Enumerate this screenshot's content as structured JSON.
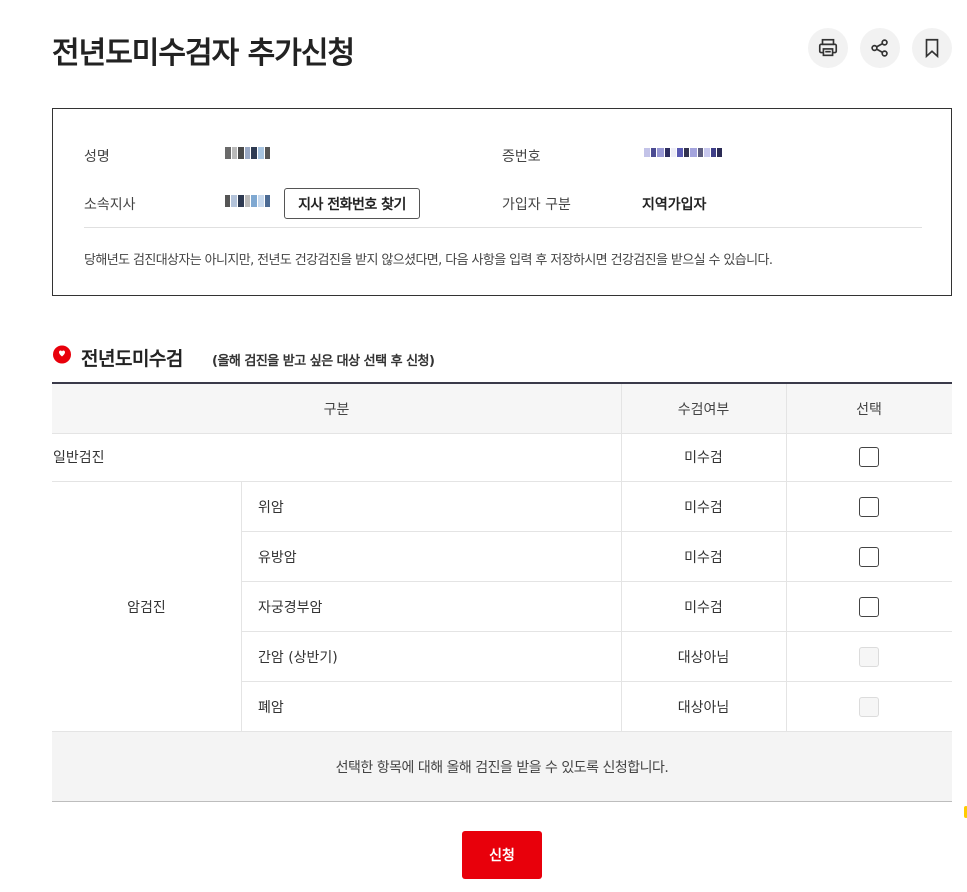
{
  "page": {
    "title": "전년도미수검자 추가신청"
  },
  "toolbar": {
    "print_icon": "print-icon",
    "share_icon": "share-icon",
    "bookmark_icon": "bookmark-icon"
  },
  "info": {
    "name_label": "성명",
    "id_label": "증번호",
    "branch_label": "소속지사",
    "find_phone_label": "지사 전화번호 찾기",
    "member_type_label": "가입자 구분",
    "member_type_value": "지역가입자",
    "notice": "당해년도 검진대상자는 아니지만, 전년도 건강검진을 받지 않으셨다면, 다음 사항을 입력 후 저장하시면 건강검진을 받으실 수 있습니다."
  },
  "section": {
    "title": "전년도미수검",
    "subtitle": "(올해 검진을 받고 싶은 대상 선택 후 신청)"
  },
  "table": {
    "headers": [
      "구분",
      "수검여부",
      "선택"
    ],
    "general": {
      "label": "일반검진",
      "status": "미수검"
    },
    "cancer_group": "암검진",
    "cancer_rows": [
      {
        "label": "위암",
        "status": "미수검"
      },
      {
        "label": "유방암",
        "status": "미수검"
      },
      {
        "label": "자궁경부암",
        "status": "미수검"
      },
      {
        "label": "간암 (상반기)",
        "status": "대상아님"
      },
      {
        "label": "폐암",
        "status": "대상아님"
      }
    ],
    "footer_note": "선택한 항목에 대해 올해 검진을 받을 수 있도록 신청합니다."
  },
  "actions": {
    "submit_label": "신청"
  },
  "colors": {
    "accent_red": "#e8000b",
    "border_dark": "#333333",
    "header_bg": "#f6f6f6"
  }
}
